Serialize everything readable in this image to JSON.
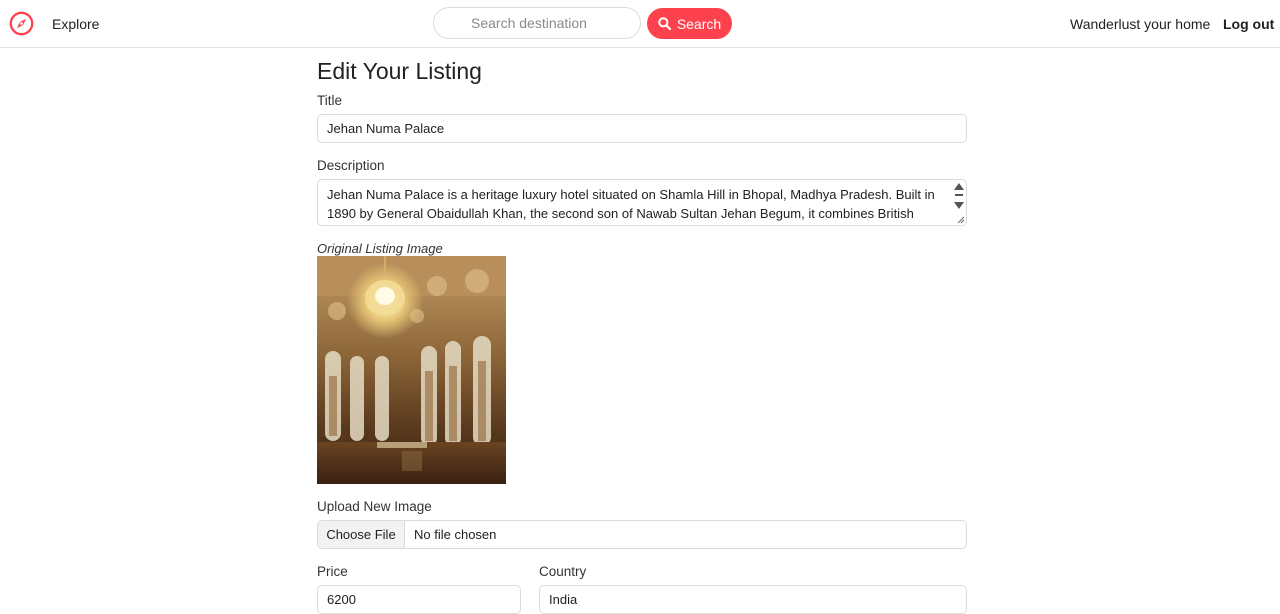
{
  "navbar": {
    "logo_icon": "compass-icon",
    "brand_color": "#fe424d",
    "explore_label": "Explore",
    "search_placeholder": "Search destination",
    "search_icon": "search-icon",
    "search_button_label": "Search",
    "host_label": "Wanderlust your home",
    "logout_label": "Log out"
  },
  "form": {
    "page_title": "Edit Your Listing",
    "title": {
      "label": "Title",
      "value": "Jehan Numa Palace"
    },
    "description": {
      "label": "Description",
      "value": "Jehan Numa Palace is a heritage luxury hotel situated on Shamla Hill in Bhopal, Madhya Pradesh. Built in 1890 by General Obaidullah Khan, the second son of Nawab Sultan Jehan Begum, it combines British Colonial,"
    },
    "original_image": {
      "caption": "Original Listing Image",
      "alt": "Palace ballroom with chandelier"
    },
    "upload": {
      "label": "Upload New Image",
      "button_label": "Choose File",
      "status": "No file chosen"
    },
    "price": {
      "label": "Price",
      "value": "6200"
    },
    "country": {
      "label": "Country",
      "value": "India"
    }
  }
}
